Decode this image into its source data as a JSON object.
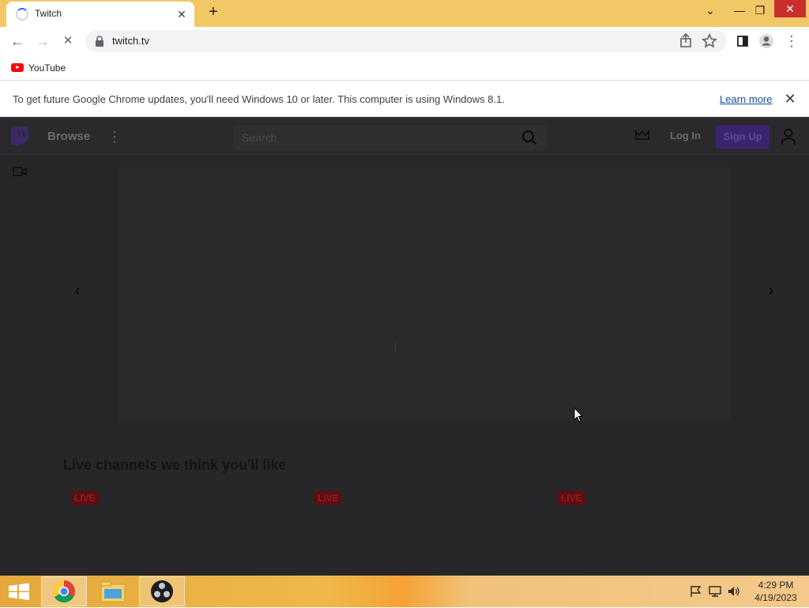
{
  "browser": {
    "tab": {
      "title": "Twitch",
      "close": "✕"
    },
    "new_tab": "+",
    "window": {
      "tab_search": "⌄",
      "minimize": "—",
      "restore": "❐",
      "close": "✕"
    },
    "toolbar": {
      "back": "←",
      "forward": "→",
      "stop": "✕",
      "url": "twitch.tv",
      "menu": "⋮"
    },
    "bookmarks": [
      {
        "label": "YouTube"
      }
    ],
    "infobar": {
      "message": "To get future Google Chrome updates, you'll need Windows 10 or later. This computer is using Windows 8.1.",
      "link": "Learn more",
      "close": "✕"
    }
  },
  "twitch": {
    "nav": {
      "browse": "Browse",
      "more": "⋮",
      "search_placeholder": "Search",
      "login": "Log In",
      "signup": "Sign Up"
    },
    "carousel": {
      "prev": "‹",
      "next": "›"
    },
    "section_title": "Live channels we think you'll like",
    "live_badges": [
      "LIVE",
      "LIVE",
      "LIVE"
    ]
  },
  "taskbar": {
    "apps": [
      "chrome-icon",
      "file-explorer-icon",
      "obs-icon"
    ],
    "clock": {
      "time": "4:29 PM",
      "date": "4/19/2023"
    }
  },
  "colors": {
    "accent_tab_strip": "#f2c866",
    "twitch_purple": "#3a2470",
    "live_red": "#5a0f12"
  }
}
